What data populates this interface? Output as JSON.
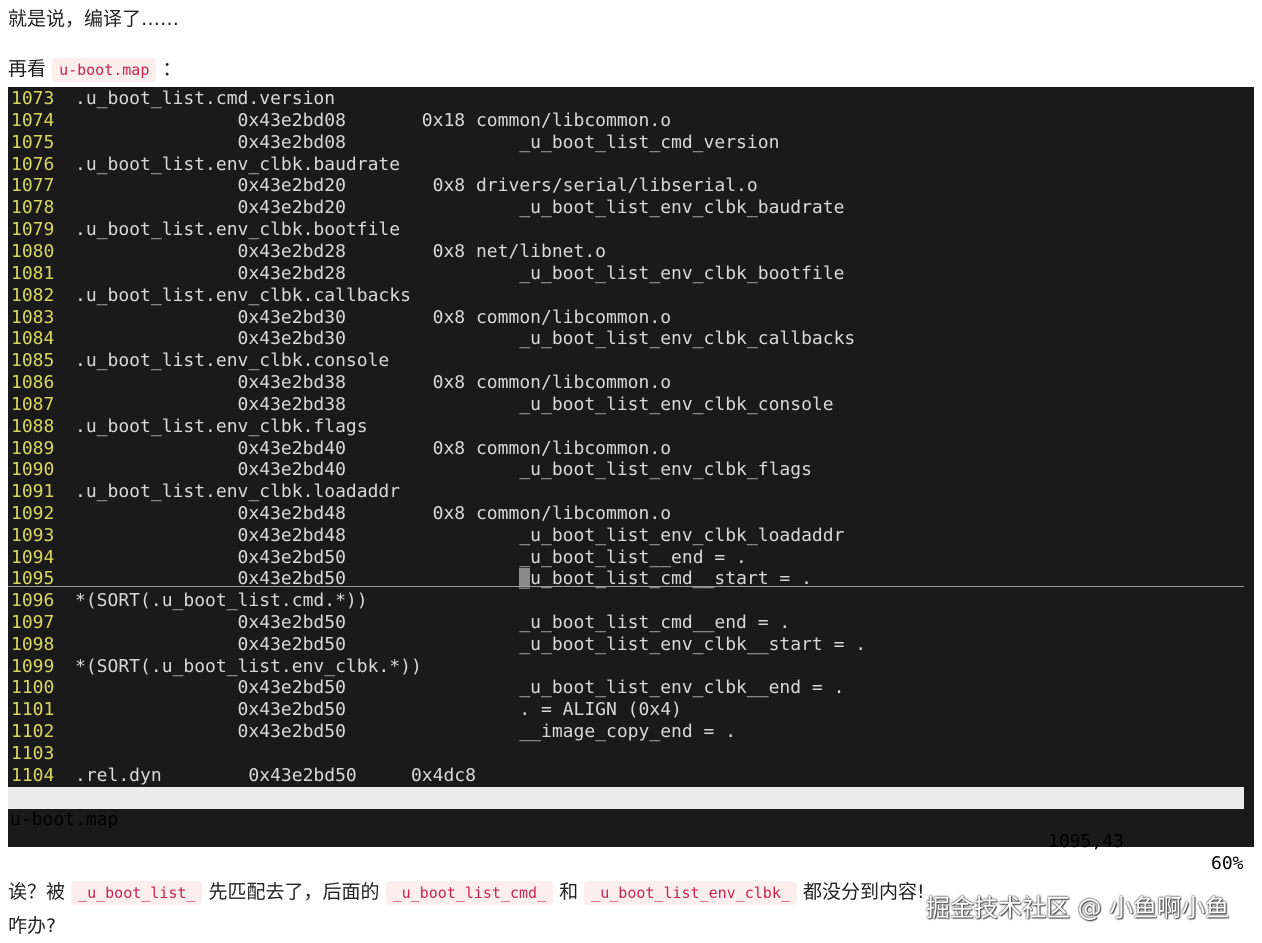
{
  "intro_text": "就是说，编译了……",
  "look_prefix": "再看",
  "map_file_code": "u-boot.map",
  "look_suffix": "：",
  "terminal": {
    "lines": [
      {
        "num": "1073",
        "text": ".u_boot_list.cmd.version"
      },
      {
        "num": "1074",
        "text": "               0x43e2bd08       0x18 common/libcommon.o"
      },
      {
        "num": "1075",
        "text": "               0x43e2bd08                _u_boot_list_cmd_version"
      },
      {
        "num": "1076",
        "text": ".u_boot_list.env_clbk.baudrate"
      },
      {
        "num": "1077",
        "text": "               0x43e2bd20        0x8 drivers/serial/libserial.o"
      },
      {
        "num": "1078",
        "text": "               0x43e2bd20                _u_boot_list_env_clbk_baudrate"
      },
      {
        "num": "1079",
        "text": ".u_boot_list.env_clbk.bootfile"
      },
      {
        "num": "1080",
        "text": "               0x43e2bd28        0x8 net/libnet.o"
      },
      {
        "num": "1081",
        "text": "               0x43e2bd28                _u_boot_list_env_clbk_bootfile"
      },
      {
        "num": "1082",
        "text": ".u_boot_list.env_clbk.callbacks"
      },
      {
        "num": "1083",
        "text": "               0x43e2bd30        0x8 common/libcommon.o"
      },
      {
        "num": "1084",
        "text": "               0x43e2bd30                _u_boot_list_env_clbk_callbacks"
      },
      {
        "num": "1085",
        "text": ".u_boot_list.env_clbk.console"
      },
      {
        "num": "1086",
        "text": "               0x43e2bd38        0x8 common/libcommon.o"
      },
      {
        "num": "1087",
        "text": "               0x43e2bd38                _u_boot_list_env_clbk_console"
      },
      {
        "num": "1088",
        "text": ".u_boot_list.env_clbk.flags"
      },
      {
        "num": "1089",
        "text": "               0x43e2bd40        0x8 common/libcommon.o"
      },
      {
        "num": "1090",
        "text": "               0x43e2bd40                _u_boot_list_env_clbk_flags"
      },
      {
        "num": "1091",
        "text": ".u_boot_list.env_clbk.loadaddr"
      },
      {
        "num": "1092",
        "text": "               0x43e2bd48        0x8 common/libcommon.o"
      },
      {
        "num": "1093",
        "text": "               0x43e2bd48                _u_boot_list_env_clbk_loadaddr"
      },
      {
        "num": "1094",
        "text": "               0x43e2bd50                _u_boot_list__end = ."
      }
    ],
    "cursor_line": {
      "num": "1095",
      "pre": "               0x43e2bd50                ",
      "cursor_char": "_",
      "post": "u_boot_list_cmd__start = ."
    },
    "lines_after": [
      {
        "num": "1096",
        "text": "*(SORT(.u_boot_list.cmd.*))"
      },
      {
        "num": "1097",
        "text": "               0x43e2bd50                _u_boot_list_cmd__end = ."
      },
      {
        "num": "1098",
        "text": "               0x43e2bd50                _u_boot_list_env_clbk__start = ."
      },
      {
        "num": "1099",
        "text": "*(SORT(.u_boot_list.env_clbk.*))"
      },
      {
        "num": "1100",
        "text": "               0x43e2bd50                _u_boot_list_env_clbk__end = ."
      },
      {
        "num": "1101",
        "text": "               0x43e2bd50                . = ALIGN (0x4)"
      },
      {
        "num": "1102",
        "text": "               0x43e2bd50                __image_copy_end = ."
      },
      {
        "num": "1103",
        "text": ""
      },
      {
        "num": "1104",
        "text": ".rel.dyn        0x43e2bd50     0x4dc8"
      }
    ],
    "status": {
      "filename": "u-boot.map",
      "position": "1095,43",
      "percent": "60%"
    }
  },
  "question": {
    "part1": "诶？被",
    "code1": "_u_boot_list_",
    "part2": "先匹配去了，后面的",
    "code2": "_u_boot_list_cmd_",
    "part3": "和",
    "code3": "_u_boot_list_env_clbk_",
    "part4": "都没分到内容!"
  },
  "closing_text": "咋办?",
  "watermark": "掘金技术社区 @ 小鱼啊小鱼"
}
